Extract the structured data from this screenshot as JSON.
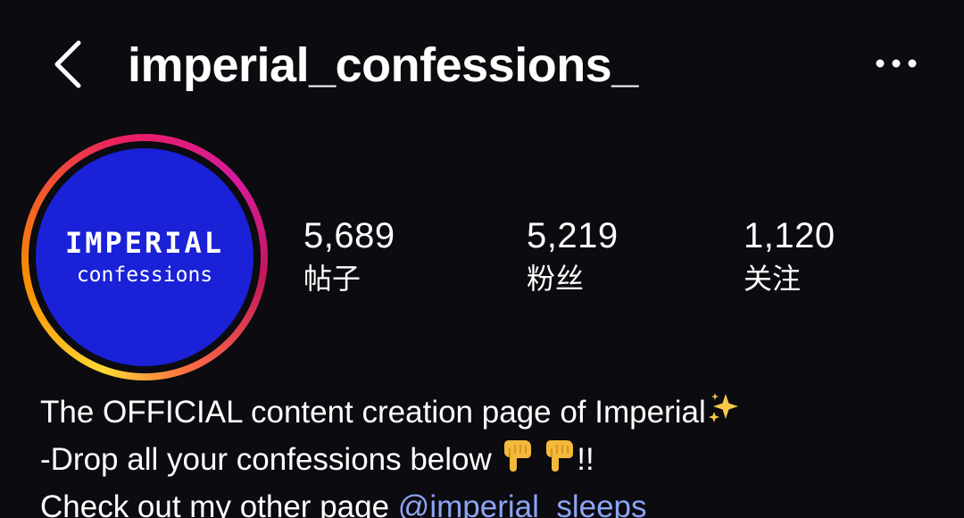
{
  "header": {
    "username": "imperial_confessions_"
  },
  "profile": {
    "avatar": {
      "title": "IMPERIAL",
      "subtitle": "confessions",
      "bg_color": "#1a21d6"
    },
    "stats": [
      {
        "value": "5,689",
        "label": "帖子"
      },
      {
        "value": "5,219",
        "label": "粉丝"
      },
      {
        "value": "1,120",
        "label": "关注"
      }
    ]
  },
  "bio": {
    "line1": "The OFFICIAL content creation page of Imperial",
    "line1_emoji": "sparkles",
    "line2": "-Drop all your confessions below",
    "line2_emojis": [
      "pointing-down",
      "pointing-down"
    ],
    "line2_suffix": "!!",
    "line3_prefix": "Check out my other page",
    "line3_link": "@imperial_sleeps",
    "link_color": "#8da4f4"
  },
  "icons": {
    "back": "chevron-left-icon",
    "more": "more-horizontal-icon"
  }
}
